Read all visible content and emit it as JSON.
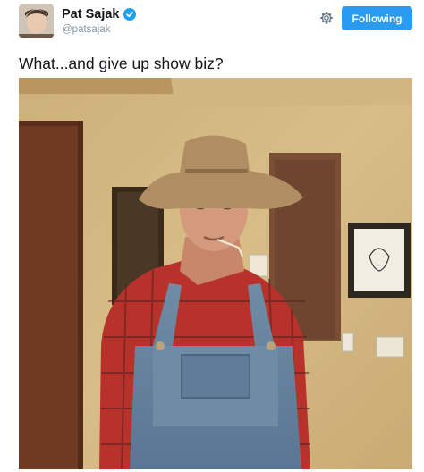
{
  "user": {
    "display_name": "Pat Sajak",
    "handle": "@patsajak",
    "verified": true
  },
  "actions": {
    "follow_label": "Following",
    "follow_color": "#2b9bf0",
    "settings_icon": "gear-icon"
  },
  "tweet": {
    "text": "What...and give up show biz?"
  },
  "colors": {
    "text": "#14171a",
    "muted": "#8899a6",
    "verified": "#1da1f2"
  }
}
